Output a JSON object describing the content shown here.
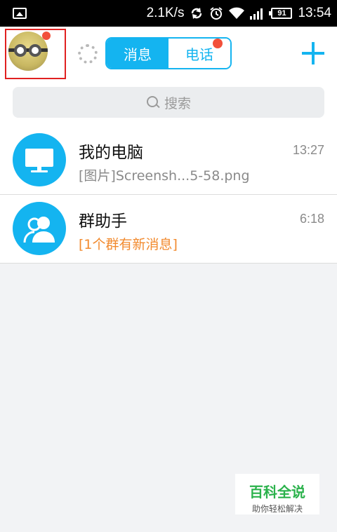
{
  "status_bar": {
    "speed": "2.1K/s",
    "battery": "91",
    "time": "13:54"
  },
  "header": {
    "tabs": [
      {
        "label": "消息",
        "active": true
      },
      {
        "label": "电话",
        "active": false
      }
    ]
  },
  "search": {
    "placeholder": "搜索"
  },
  "conversations": [
    {
      "title": "我的电脑",
      "subtitle": "[图片]Screensh...5-58.png",
      "time": "13:27",
      "icon": "monitor-icon"
    },
    {
      "title": "群助手",
      "subtitle": "[1个群有新消息]",
      "time": "6:18",
      "icon": "group-people-icon"
    }
  ],
  "watermark": {
    "title": "百科全说",
    "subtitle": "助你轻松解决"
  },
  "colors": {
    "accent": "#14b4f0",
    "badge": "#f2503a",
    "orange_text": "#f28a2e",
    "highlight_box": "#e02020"
  }
}
